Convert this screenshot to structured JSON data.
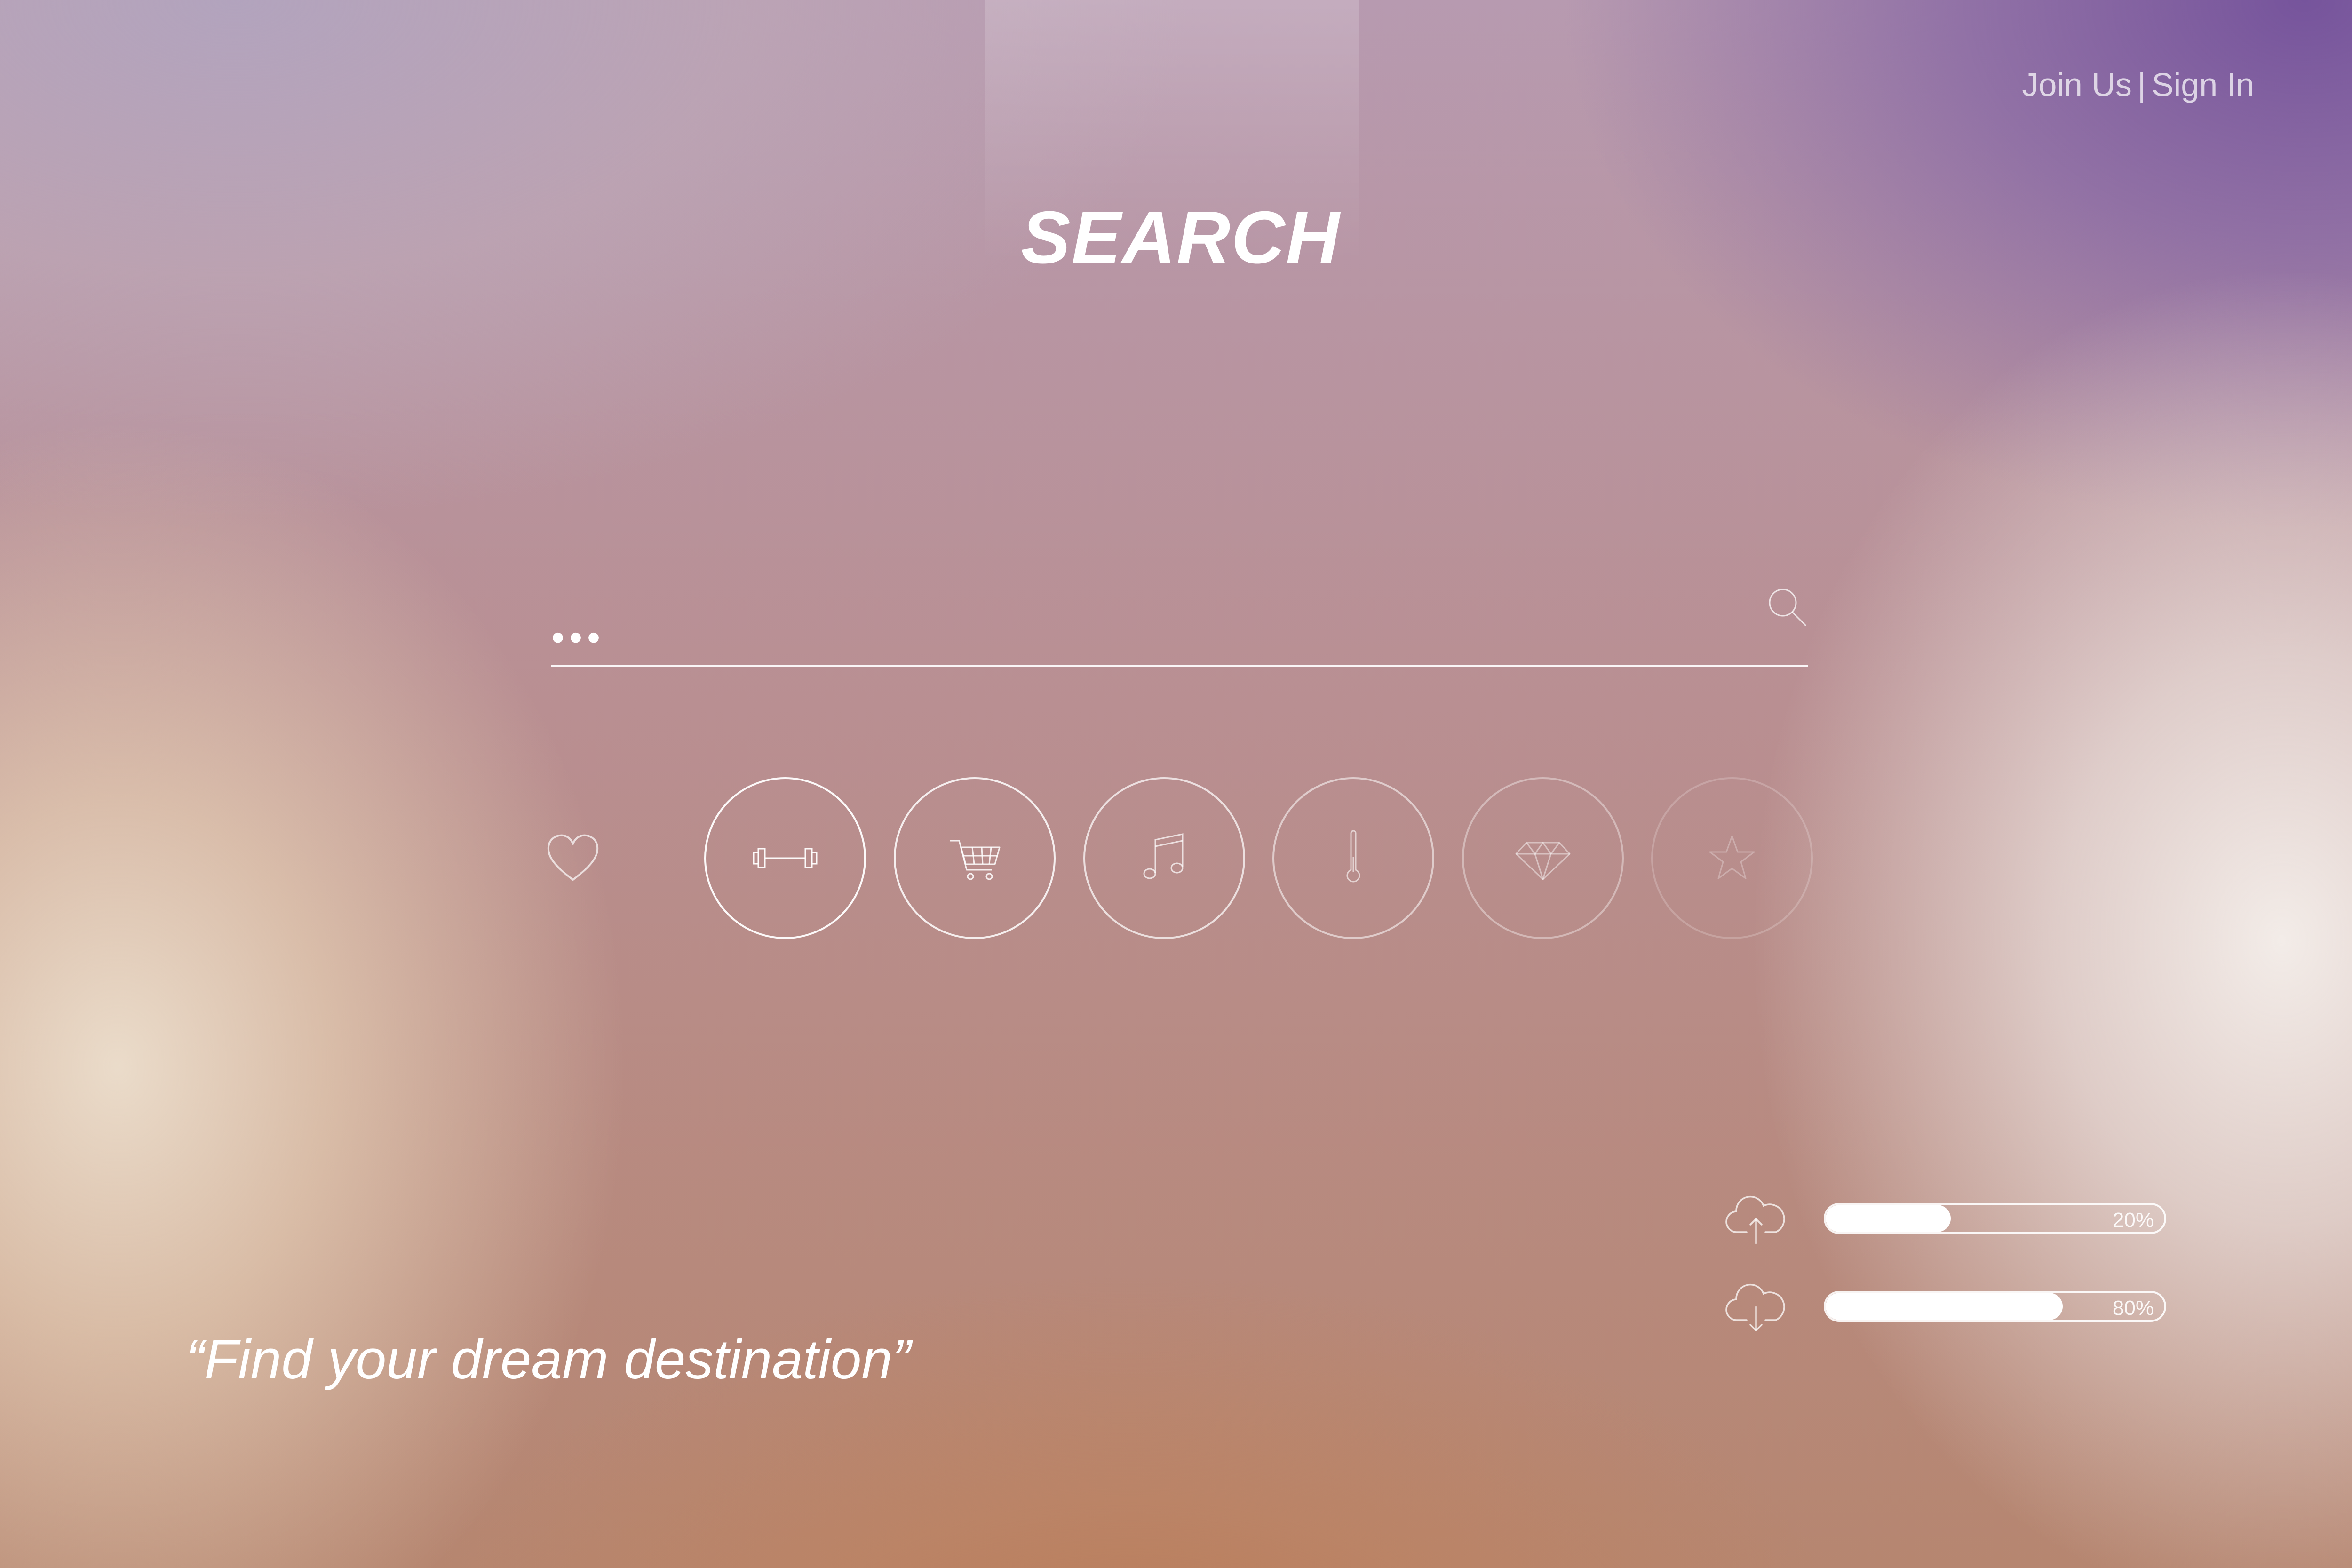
{
  "header": {
    "join_label": "Join Us",
    "separator": "|",
    "sign_in_label": "Sign In"
  },
  "title": "SEARCH",
  "search": {
    "value": "",
    "placeholder": "•••",
    "icon": "search-icon"
  },
  "favorite": {
    "icon": "heart-icon"
  },
  "categories": [
    {
      "icon": "dumbbell-icon"
    },
    {
      "icon": "shopping-cart-icon"
    },
    {
      "icon": "music-note-icon"
    },
    {
      "icon": "thermometer-icon"
    },
    {
      "icon": "diamond-icon"
    },
    {
      "icon": "star-icon"
    }
  ],
  "quote": "“Find your dream destination”",
  "transfers": [
    {
      "icon": "cloud-upload-icon",
      "label": "20%",
      "fill": 0.37
    },
    {
      "icon": "cloud-download-icon",
      "label": "80%",
      "fill": 0.7
    }
  ],
  "colors": {
    "text": "#ffffff",
    "top_right_purple": "#7a5699",
    "bottom_orange": "#ba7c5a",
    "left_cream": "#ecdecc",
    "right_white": "#f4eeea"
  }
}
